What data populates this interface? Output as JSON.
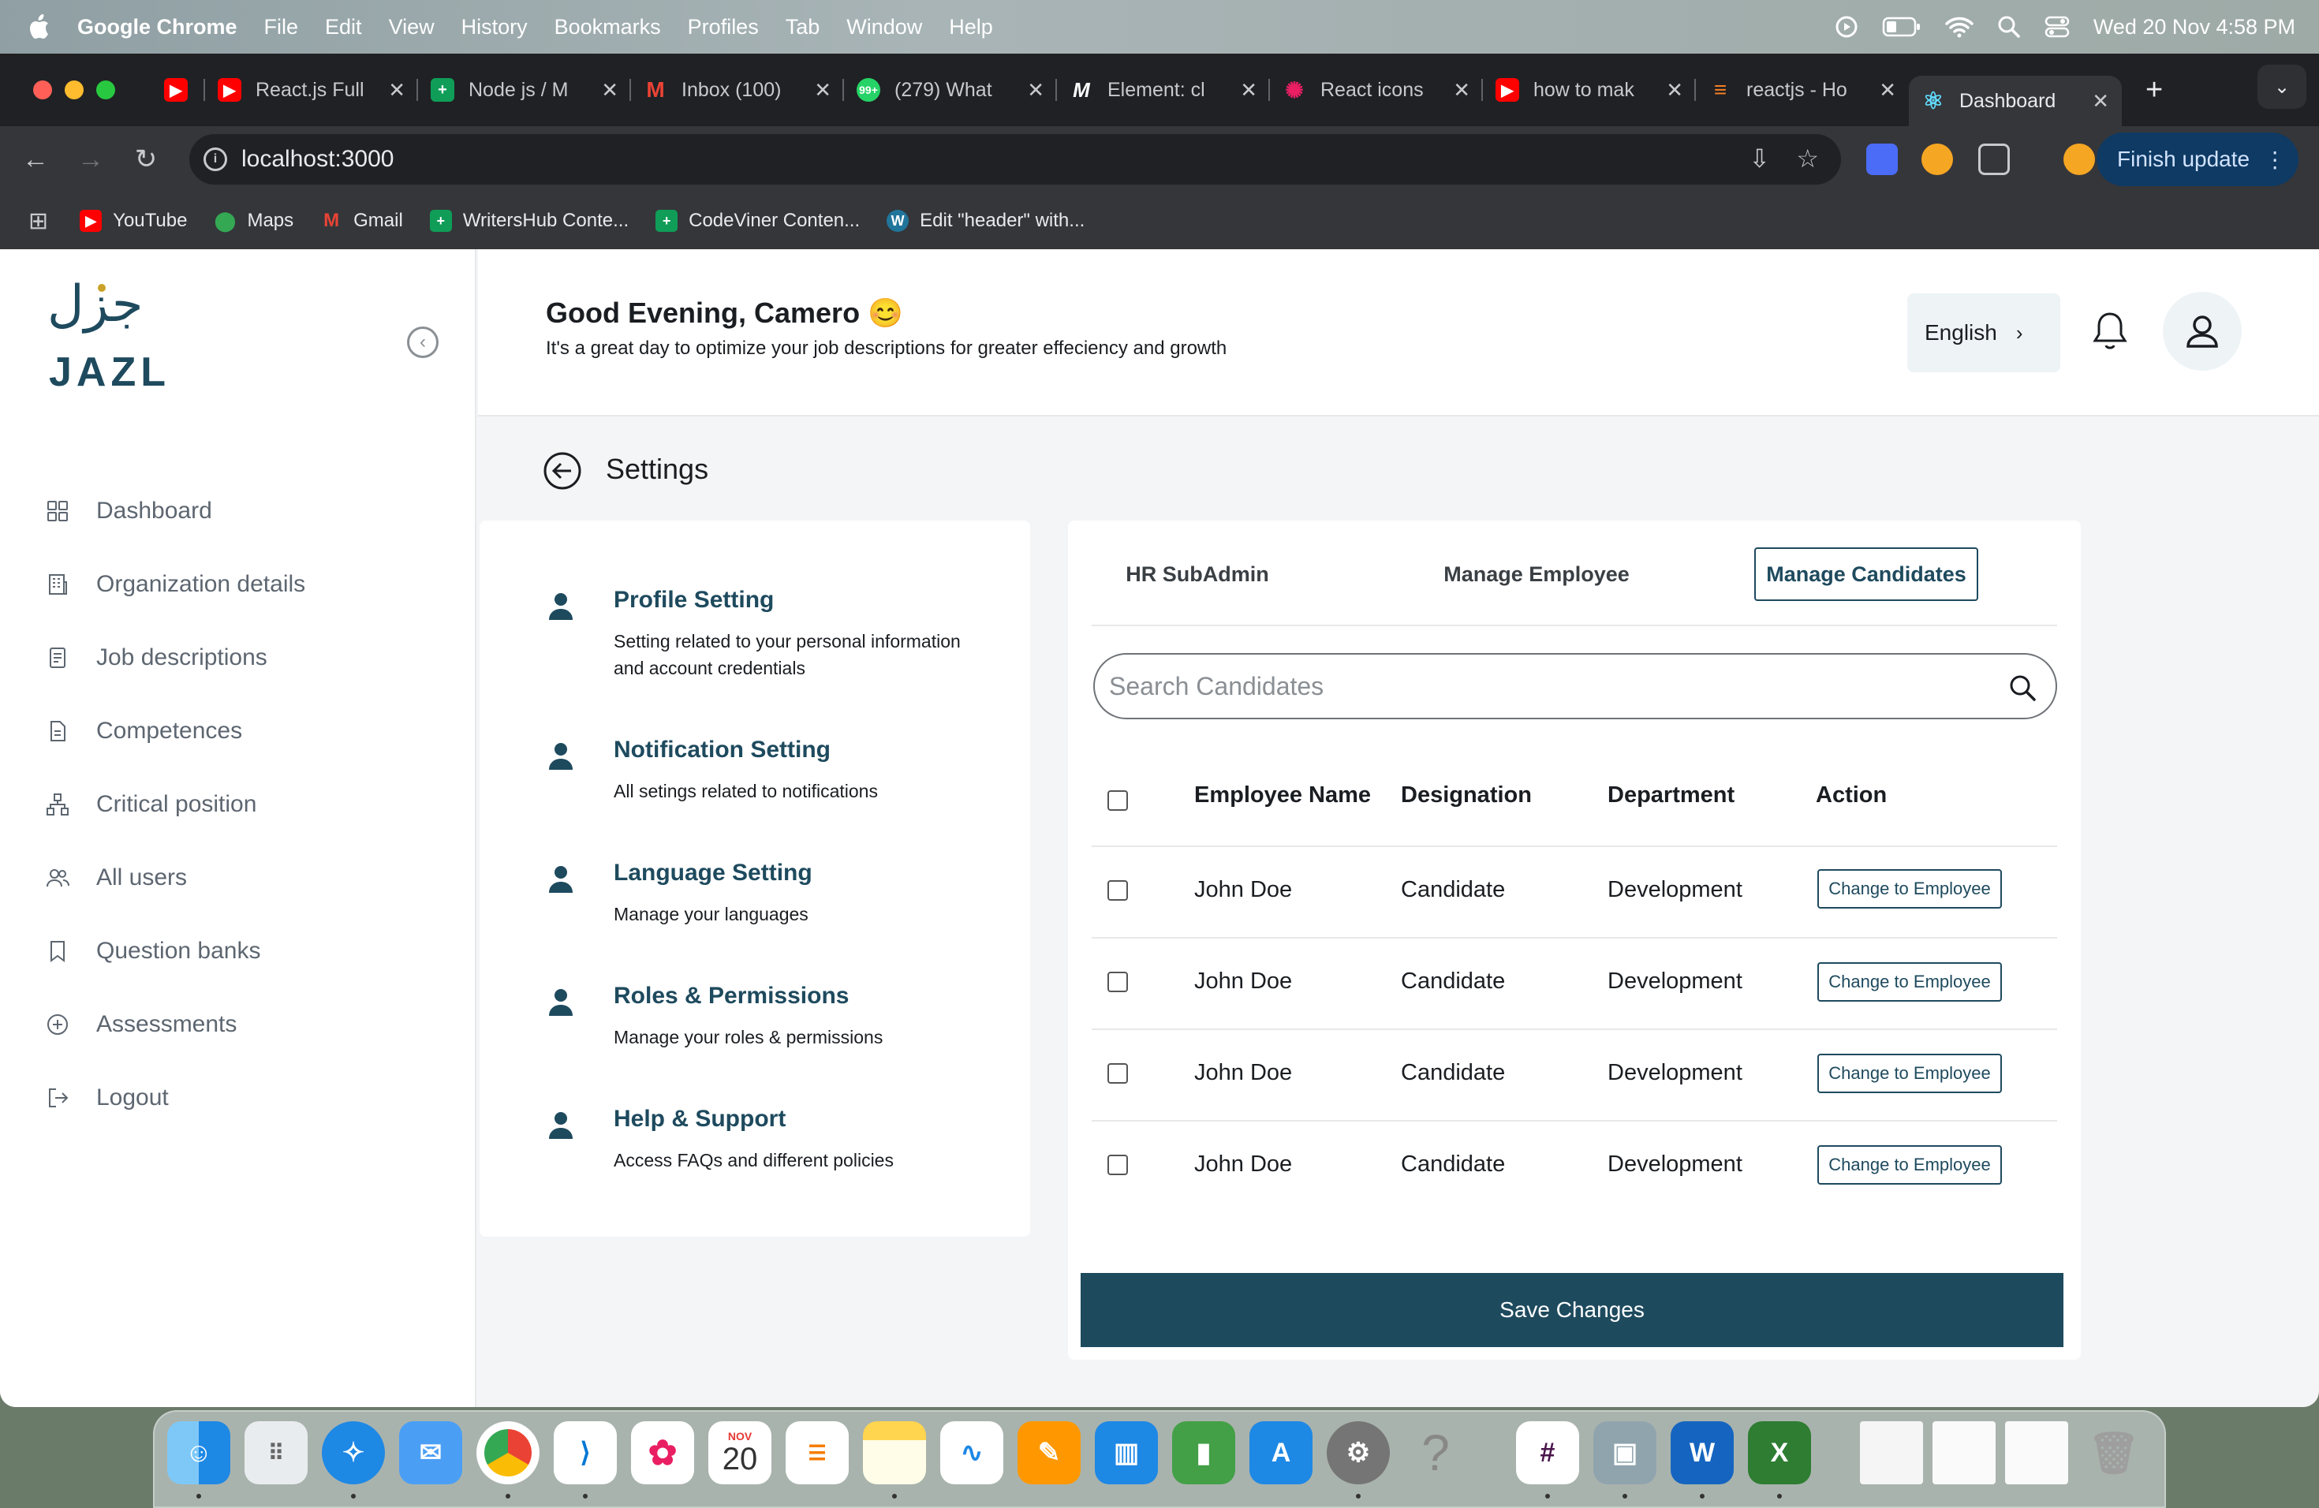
{
  "menubar": {
    "app_name": "Google Chrome",
    "items": [
      "File",
      "Edit",
      "View",
      "History",
      "Bookmarks",
      "Profiles",
      "Tab",
      "Window",
      "Help"
    ],
    "datetime": "Wed 20 Nov  4:58 PM"
  },
  "browser": {
    "tabs": [
      {
        "title": "",
        "favicon": "youtube-icon",
        "color": "#ff0000"
      },
      {
        "title": "React.js Full",
        "favicon": "youtube-icon",
        "color": "#ff0000"
      },
      {
        "title": "Node js / M",
        "favicon": "sheets-icon",
        "color": "#0f9d58"
      },
      {
        "title": "Inbox (100)",
        "favicon": "gmail-icon",
        "color": "#ea4335"
      },
      {
        "title": "(279) What",
        "favicon": "whatsapp-icon",
        "color": "#25d366"
      },
      {
        "title": "Element: cl",
        "favicon": "mdn-icon",
        "color": "#ffffff"
      },
      {
        "title": "React icons",
        "favicon": "react-icons-icon",
        "color": "#e91e63"
      },
      {
        "title": "how to mak",
        "favicon": "youtube-icon",
        "color": "#ff0000"
      },
      {
        "title": "reactjs - Ho",
        "favicon": "stackoverflow-icon",
        "color": "#f48024"
      },
      {
        "title": "Dashboard",
        "favicon": "react-icon",
        "color": "#61dafb"
      }
    ],
    "new_tab": "+",
    "url": "localhost:3000",
    "finish_update": "Finish update",
    "bookmarks": [
      {
        "label": "YouTube",
        "icon": "youtube-icon",
        "color": "#ff0000"
      },
      {
        "label": "Maps",
        "icon": "maps-icon",
        "color": "#34a853"
      },
      {
        "label": "Gmail",
        "icon": "gmail-icon",
        "color": "#ea4335"
      },
      {
        "label": "WritersHub Conte...",
        "icon": "sheets-icon",
        "color": "#0f9d58"
      },
      {
        "label": "CodeViner Conten...",
        "icon": "sheets-icon",
        "color": "#0f9d58"
      },
      {
        "label": "Edit \"header\" with...",
        "icon": "wordpress-icon",
        "color": "#21759b"
      }
    ]
  },
  "sidebar": {
    "logo_arabic": "جزل",
    "logo_text": "JAZL",
    "items": [
      {
        "label": "Dashboard",
        "icon": "grid-icon"
      },
      {
        "label": "Organization details",
        "icon": "building-icon"
      },
      {
        "label": "Job descriptions",
        "icon": "document-icon"
      },
      {
        "label": "Competences",
        "icon": "file-icon"
      },
      {
        "label": "Critical position",
        "icon": "hierarchy-icon"
      },
      {
        "label": "All users",
        "icon": "users-icon"
      },
      {
        "label": "Question banks",
        "icon": "bookmark-icon"
      },
      {
        "label": "Assessments",
        "icon": "plus-circle-icon"
      },
      {
        "label": "Logout",
        "icon": "logout-icon"
      }
    ]
  },
  "header": {
    "greeting": "Good Evening, Camero 😊",
    "subtitle": "It's a great day to optimize your job descriptions for greater effeciency and growth",
    "language": "English"
  },
  "settings": {
    "title": "Settings",
    "options": [
      {
        "title": "Profile Setting",
        "desc": "Setting related to your personal information and account credentials"
      },
      {
        "title": "Notification Setting",
        "desc": "All setings related to notifications"
      },
      {
        "title": "Language Setting",
        "desc": "Manage your languages"
      },
      {
        "title": "Roles & Permissions",
        "desc": "Manage your roles & permissions"
      },
      {
        "title": "Help & Support",
        "desc": "Access FAQs and different policies"
      }
    ]
  },
  "manage": {
    "tabs": [
      "HR SubAdmin",
      "Manage Employee",
      "Manage Candidates"
    ],
    "active_tab": "Manage Candidates",
    "search_placeholder": "Search Candidates",
    "columns": [
      "Employee Name",
      "Designation",
      "Department",
      "Action"
    ],
    "rows": [
      {
        "name": "John Doe",
        "designation": "Candidate",
        "department": "Development",
        "action": "Change to Employee"
      },
      {
        "name": "John Doe",
        "designation": "Candidate",
        "department": "Development",
        "action": "Change to Employee"
      },
      {
        "name": "John Doe",
        "designation": "Candidate",
        "department": "Development",
        "action": "Change to Employee"
      },
      {
        "name": "John Doe",
        "designation": "Candidate",
        "department": "Development",
        "action": "Change to Employee"
      }
    ],
    "save_label": "Save Changes"
  },
  "dock": {
    "calendar_month": "NOV",
    "calendar_day": "20",
    "apps": [
      "finder",
      "launchpad",
      "safari",
      "mail",
      "chrome",
      "vscode",
      "photos",
      "calendar",
      "reminders",
      "notes",
      "freeform",
      "pages",
      "keynote",
      "numbers",
      "app-store",
      "system-settings",
      "help",
      "slack",
      "preview",
      "word",
      "excel",
      "document",
      "screenshot",
      "screenshot",
      "trash"
    ]
  },
  "colors": {
    "primary": "#1e4a5e",
    "brand_gold": "#c9a227"
  }
}
